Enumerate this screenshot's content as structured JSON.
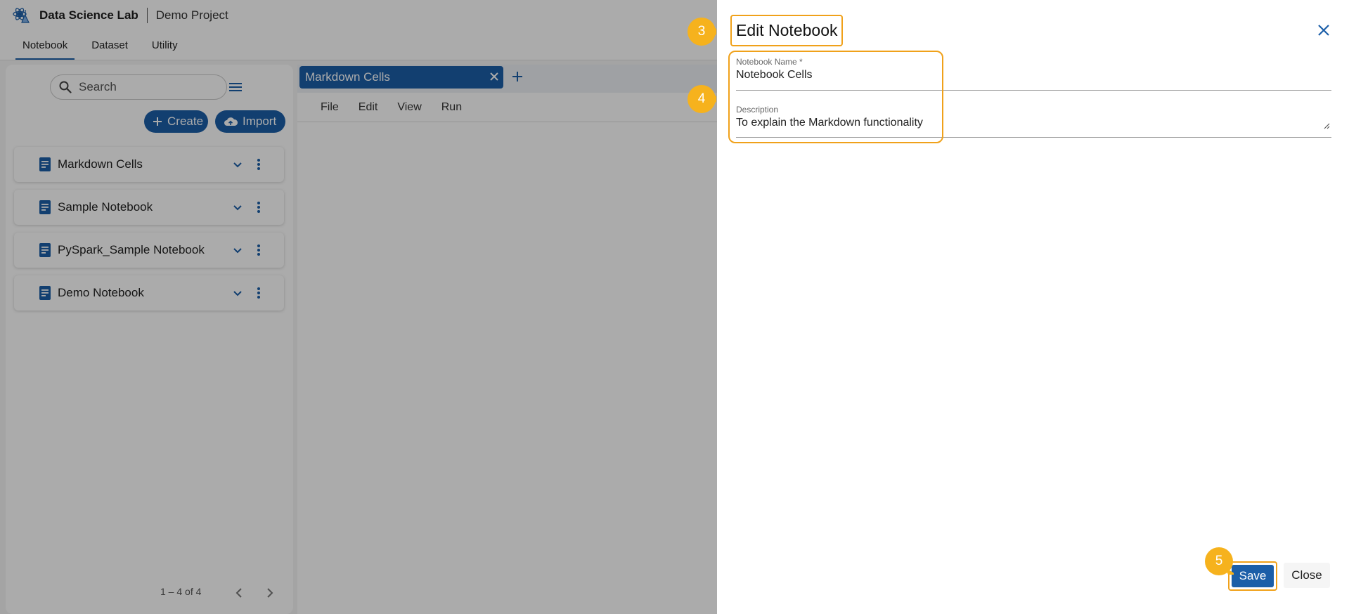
{
  "header": {
    "app_name": "Data Science Lab",
    "project_name": "Demo Project",
    "logo_icon": "flask-atom-icon"
  },
  "nav": {
    "tabs": [
      {
        "label": "Notebook",
        "active": true
      },
      {
        "label": "Dataset",
        "active": false
      },
      {
        "label": "Utility",
        "active": false
      }
    ]
  },
  "sidebar": {
    "search": {
      "placeholder": "Search"
    },
    "create_label": "Create",
    "import_label": "Import",
    "notebooks": [
      {
        "label": "Markdown Cells"
      },
      {
        "label": "Sample Notebook"
      },
      {
        "label": "PySpark_Sample Notebook"
      },
      {
        "label": "Demo Notebook"
      }
    ],
    "pagination": "1 – 4 of 4"
  },
  "editor": {
    "open_tab": "Markdown Cells",
    "menu": [
      "File",
      "Edit",
      "View",
      "Run"
    ]
  },
  "drawer": {
    "title": "Edit Notebook",
    "name_label": "Notebook Name *",
    "name_value": "Notebook Cells",
    "description_label": "Description",
    "description_value": "To explain the Markdown functionality",
    "save_label": "Save",
    "close_label": "Close"
  },
  "annotations": {
    "steps": [
      "3",
      "4",
      "5"
    ],
    "highlight_color": "#f0a11a"
  },
  "colors": {
    "primary": "#1b5ea8",
    "step_badge": "#f6b21d"
  }
}
